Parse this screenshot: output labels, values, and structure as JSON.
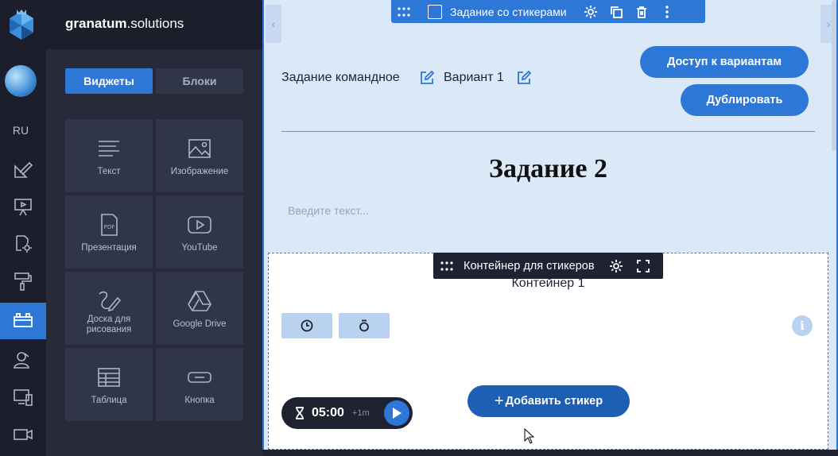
{
  "brand": {
    "bold": "granatum",
    "rest": ".solutions"
  },
  "rail": {
    "lang": "RU"
  },
  "tabs": {
    "widgets": "Виджеты",
    "blocks": "Блоки"
  },
  "widgets": [
    {
      "label": "Текст",
      "icon": "text-icon"
    },
    {
      "label": "Изображение",
      "icon": "image-icon"
    },
    {
      "label": "Презентация",
      "icon": "pdf-icon"
    },
    {
      "label": "YouTube",
      "icon": "youtube-icon"
    },
    {
      "label": "Доска для рисования",
      "icon": "draw-icon"
    },
    {
      "label": "Google Drive",
      "icon": "google-drive-icon"
    },
    {
      "label": "Таблица",
      "icon": "table-icon"
    },
    {
      "label": "Кнопка",
      "icon": "button-icon"
    }
  ],
  "toolbar": {
    "title": "Задание со стикерами"
  },
  "header": {
    "task_type": "Задание командное",
    "variant": "Вариант 1",
    "access_btn": "Доступ к вариантам",
    "duplicate_btn": "Дублировать"
  },
  "content": {
    "title": "Задание 2",
    "placeholder": "Введите текст..."
  },
  "sticker_container": {
    "bar_title": "Контейнер для стикеров",
    "title": "Контейнер 1",
    "add_btn": "Добавить стикер"
  },
  "timer": {
    "value": "05:00",
    "increment": "+1m"
  },
  "colors": {
    "accent": "#2d78d6",
    "dark": "#1f2230",
    "canvas": "#dbe8f8"
  }
}
